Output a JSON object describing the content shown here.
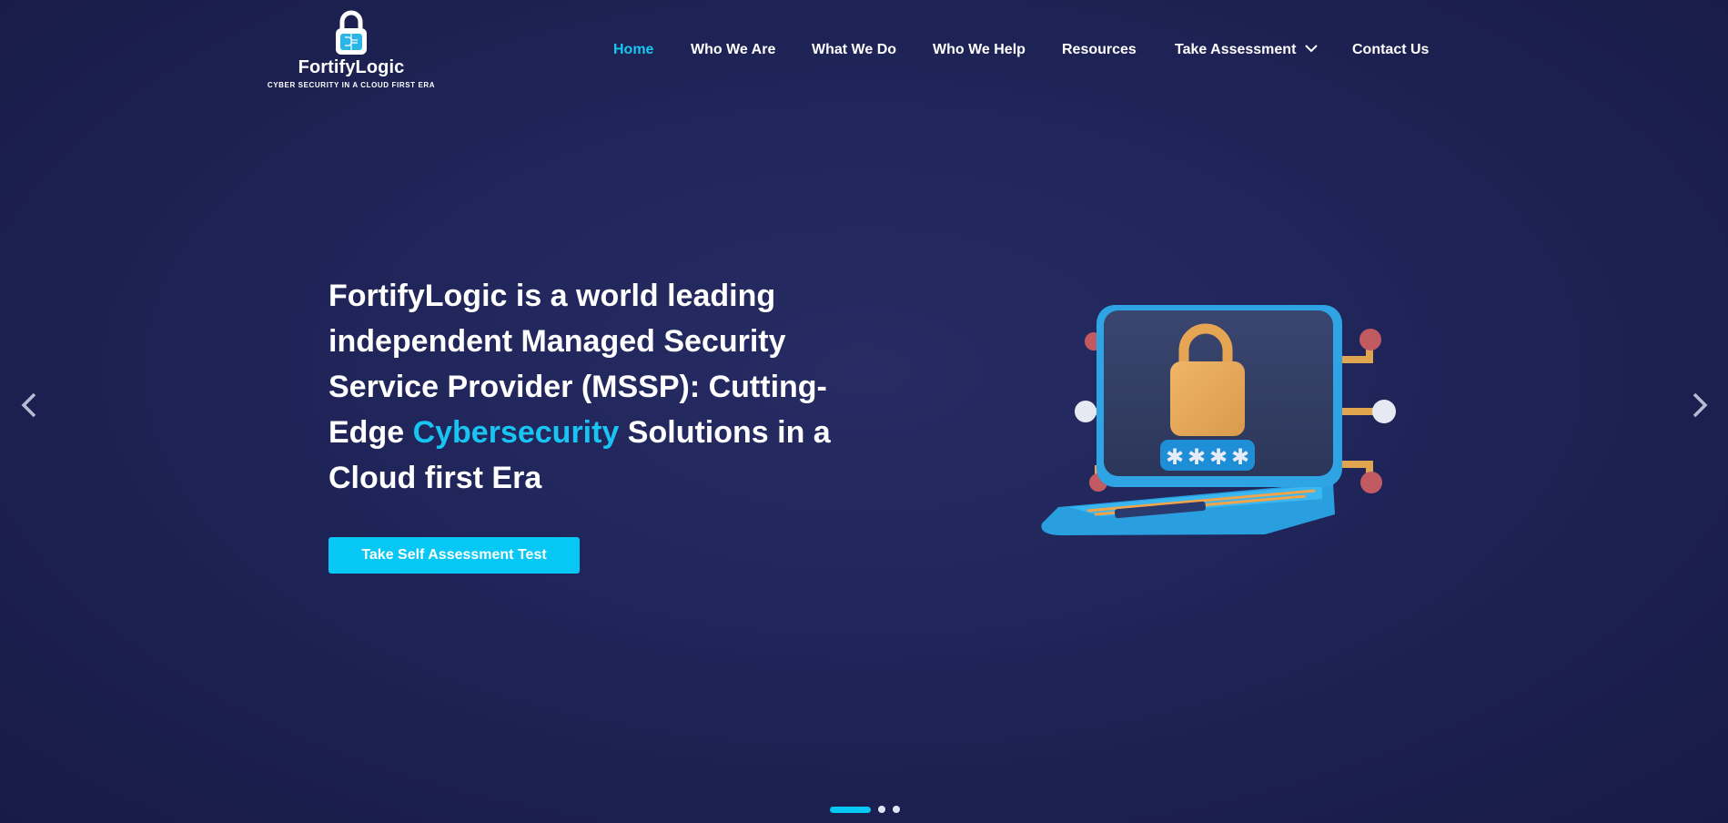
{
  "brand": {
    "name": "FortifyLogic",
    "tagline": "CYBER SECURITY IN A CLOUD FIRST ERA"
  },
  "nav": {
    "items": [
      {
        "label": "Home",
        "active": true
      },
      {
        "label": "Who We Are"
      },
      {
        "label": "What We Do"
      },
      {
        "label": "Who We Help"
      },
      {
        "label": "Resources"
      },
      {
        "label": "Take Assessment",
        "has_dropdown": true
      },
      {
        "label": "Contact Us"
      }
    ]
  },
  "hero": {
    "heading_pre": "FortifyLogic is a world leading independent Managed Security Service Provider (MSSP): Cutting-Edge ",
    "heading_highlight": "Cybersecurity",
    "heading_post": " Solutions in a Cloud first Era",
    "cta_label": "Take Self Assessment Test",
    "illustration_icon": "laptop-lock-password-icon"
  },
  "carousel": {
    "prev_icon": "chevron-left-icon",
    "next_icon": "chevron-right-icon",
    "slide_count": 3,
    "active_slide": 1
  },
  "colors": {
    "accent": "#07c8f4",
    "background": "#20255a",
    "text": "#ffffff"
  }
}
